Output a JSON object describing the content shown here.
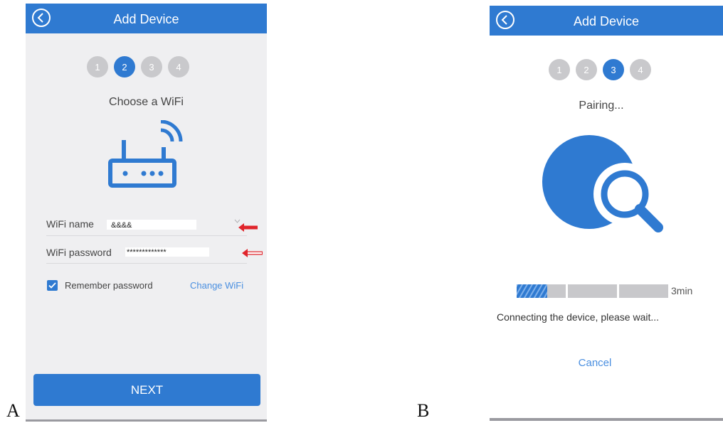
{
  "panels": {
    "a_label": "A",
    "b_label": "B"
  },
  "screen_a": {
    "header_title": "Add Device",
    "steps": [
      "1",
      "2",
      "3",
      "4"
    ],
    "active_step": 2,
    "subtitle": "Choose a WiFi",
    "wifi_name_label": "WiFi name",
    "wifi_name_value": "&&&&",
    "wifi_password_label": "WiFi password",
    "wifi_password_value": "*************",
    "remember_label": "Remember password",
    "remember_checked": true,
    "change_wifi_label": "Change WiFi",
    "next_label": "NEXT",
    "icons": [
      "back-icon",
      "router-icon",
      "chevron-down-icon",
      "checkmark-icon"
    ]
  },
  "screen_b": {
    "header_title": "Add Device",
    "steps": [
      "1",
      "2",
      "3",
      "4"
    ],
    "active_step": 3,
    "subtitle": "Pairing...",
    "timer_text": "3min",
    "progress_fraction": 0.2,
    "status_text": "Connecting the device, please wait...",
    "cancel_label": "Cancel",
    "icons": [
      "back-icon",
      "search-device-icon"
    ]
  },
  "annotations": {
    "arrow_color": "#e0242b",
    "arrows": [
      "wifi-name-arrow",
      "wifi-password-arrow"
    ]
  },
  "colors": {
    "accent": "#2f7ad1",
    "inactive_step": "#c9c9cc",
    "screen_a_background": "#efeff1"
  }
}
